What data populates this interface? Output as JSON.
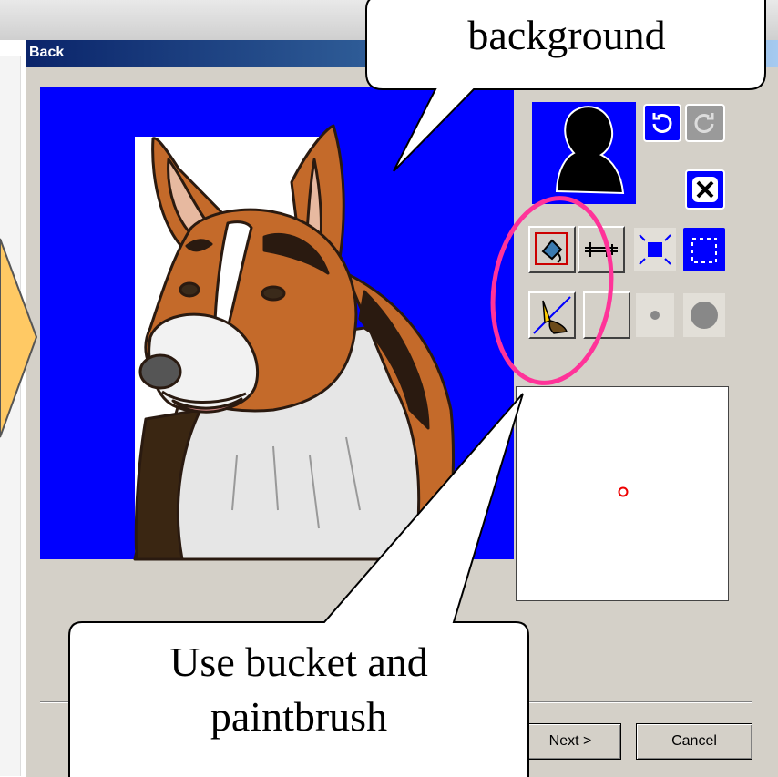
{
  "window": {
    "title": "Back"
  },
  "callouts": {
    "top": "background",
    "bottom_line1": "Use bucket and",
    "bottom_line2": "paintbrush"
  },
  "buttons": {
    "next": "Next >",
    "cancel": "Cancel"
  },
  "colors": {
    "canvas_bg": "#0000ff",
    "highlight_ellipse": "#ff3399",
    "side_arrow": "#ffc964"
  },
  "icons": [
    "undo-icon",
    "redo-icon",
    "close-icon",
    "bucket-icon",
    "ruler-icon",
    "zoom-in-icon",
    "zoom-out-icon",
    "paintbrush-icon",
    "small-dot-icon",
    "large-dot-icon",
    "crosshair-icon"
  ]
}
